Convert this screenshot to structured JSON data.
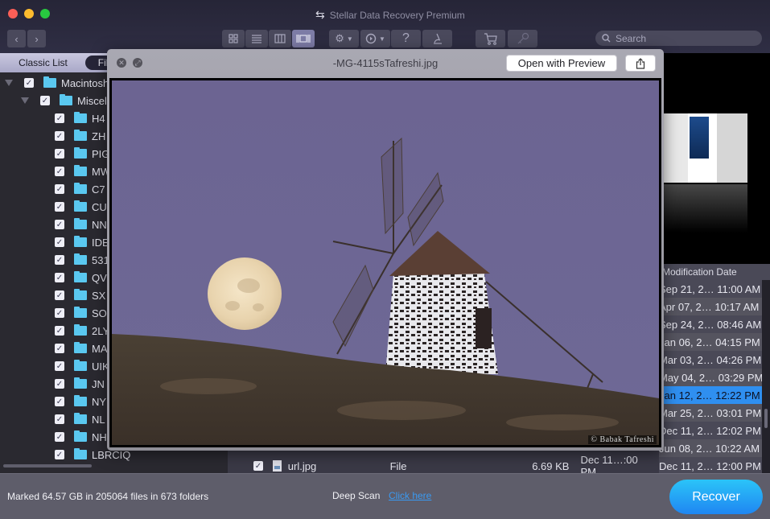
{
  "window": {
    "title": "Stellar Data Recovery Premium"
  },
  "toolbar": {
    "nav_back": "‹",
    "nav_forward": "›",
    "view_modes": [
      {
        "name": "icon-view",
        "icon": "grid-icon",
        "active": false
      },
      {
        "name": "list-view",
        "icon": "list-icon",
        "active": false
      },
      {
        "name": "column-view",
        "icon": "columns-icon",
        "active": false
      },
      {
        "name": "coverflow-view",
        "icon": "coverflow-icon",
        "active": true
      }
    ],
    "help_label": "?",
    "search_placeholder": "Search"
  },
  "sidebar": {
    "tabs": [
      {
        "label": "Classic List",
        "active": false
      },
      {
        "label": "File Type",
        "active": true
      }
    ],
    "tree": [
      {
        "label": "Macintosh",
        "level": 0,
        "expanded": true,
        "checked": true
      },
      {
        "label": "Miscel",
        "level": 1,
        "expanded": true,
        "checked": true
      },
      {
        "label": "H4",
        "level": 2,
        "checked": true
      },
      {
        "label": "ZH",
        "level": 2,
        "checked": true
      },
      {
        "label": "PIG",
        "level": 2,
        "checked": true
      },
      {
        "label": "MW",
        "level": 2,
        "checked": true
      },
      {
        "label": "C7",
        "level": 2,
        "checked": true
      },
      {
        "label": "CU",
        "level": 2,
        "checked": true
      },
      {
        "label": "NN",
        "level": 2,
        "checked": true
      },
      {
        "label": "IDE",
        "level": 2,
        "checked": true
      },
      {
        "label": "531",
        "level": 2,
        "checked": true
      },
      {
        "label": "QV",
        "level": 2,
        "checked": true
      },
      {
        "label": "SX",
        "level": 2,
        "checked": true
      },
      {
        "label": "SO",
        "level": 2,
        "checked": true
      },
      {
        "label": "2LY",
        "level": 2,
        "checked": true
      },
      {
        "label": "MA",
        "level": 2,
        "checked": true
      },
      {
        "label": "UIK",
        "level": 2,
        "checked": true
      },
      {
        "label": "JN",
        "level": 2,
        "checked": true
      },
      {
        "label": "NY",
        "level": 2,
        "checked": true
      },
      {
        "label": "NL",
        "level": 2,
        "checked": true
      },
      {
        "label": "NH",
        "level": 2,
        "checked": true
      },
      {
        "label": "LBRCIQ",
        "level": 2,
        "checked": true
      }
    ]
  },
  "file_list": {
    "modification_date_header": "Modification Date",
    "dates": [
      "Sep 21, 2… 11:00 AM",
      "Apr 07, 2… 10:17 AM",
      "Sep 24, 2… 08:46 AM",
      "Jan 06, 2… 04:15 PM",
      "Mar 03, 2… 04:26 PM",
      "May 04, 2… 03:29 PM",
      "Jan 12, 2… 12:22 PM",
      "Mar 25, 2… 03:01 PM",
      "Dec 11, 2… 12:02 PM",
      "Jun 08, 2… 10:22 AM",
      "Dec 11, 2… 12:00 PM"
    ],
    "selected_index": 6,
    "visible_row": {
      "name": "url.jpg",
      "type": "File",
      "size": "6.69 KB",
      "date": "Dec 11…:00 PM",
      "checked": true
    }
  },
  "quicklook": {
    "filename": "-MG-4115sTafreshi.jpg",
    "open_with_label": "Open with Preview",
    "image_credit": "© Babak Tafreshi"
  },
  "status": {
    "summary": "Marked 64.57 GB in 205064 files in 673 folders",
    "deep_scan_label": "Deep Scan",
    "deep_scan_link": "Click here",
    "recover_label": "Recover"
  },
  "colors": {
    "accent_blue": "#2f8ff0",
    "recover_gradient_top": "#2bc4f8",
    "recover_gradient_bottom": "#1f86f2",
    "folder_blue": "#5ac8f0",
    "link_blue": "#3a9af2"
  }
}
